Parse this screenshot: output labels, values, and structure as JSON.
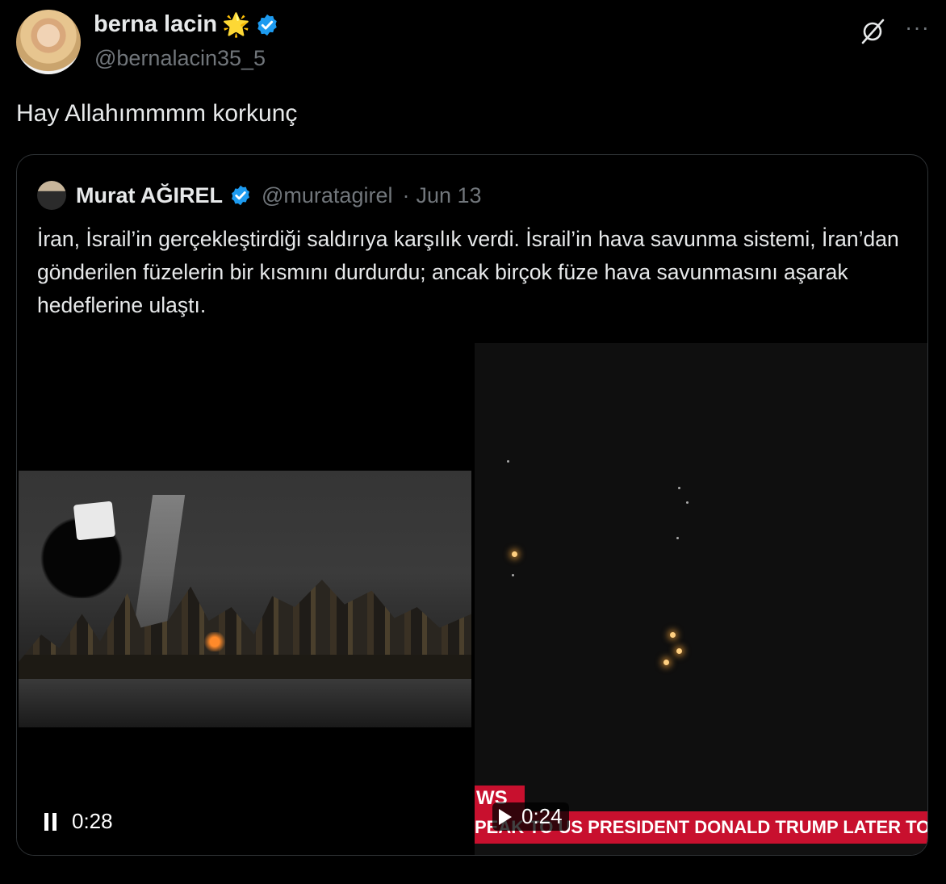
{
  "post": {
    "author_name": "berna lacin",
    "author_emoji": "🌟",
    "author_handle": "@bernalacin35_5",
    "text": "Hay Allahımmmm korkunç",
    "more_label": "···"
  },
  "quote": {
    "author_name": "Murat AĞIREL",
    "author_handle": "@muratagirel",
    "separator": "·",
    "date": "Jun 13",
    "text": "İran, İsrail’in gerçekleştirdiği saldırıya karşılık verdi. İsrail’in hava savunma sistemi, İran’dan gönderilen füzelerin bir kısmını durdurdu; ancak birçok füze hava savunmasını aşarak hedeflerine ulaştı."
  },
  "media": {
    "left_video": {
      "time": "0:28",
      "state": "playing"
    },
    "right_video": {
      "time": "0:24",
      "state": "paused",
      "news_tab": "WS",
      "news_ticker": "PEAK TO US PRESIDENT DONALD TRUMP LATER TODAY"
    }
  },
  "colors": {
    "background": "#000000",
    "text": "#e7e9ea",
    "secondary_text": "#71767b",
    "verified": "#1d9bf0",
    "news_red": "#c8102e"
  },
  "icons": [
    "verified-badge-icon",
    "grok-icon",
    "more-options-icon",
    "pause-icon",
    "play-icon"
  ]
}
